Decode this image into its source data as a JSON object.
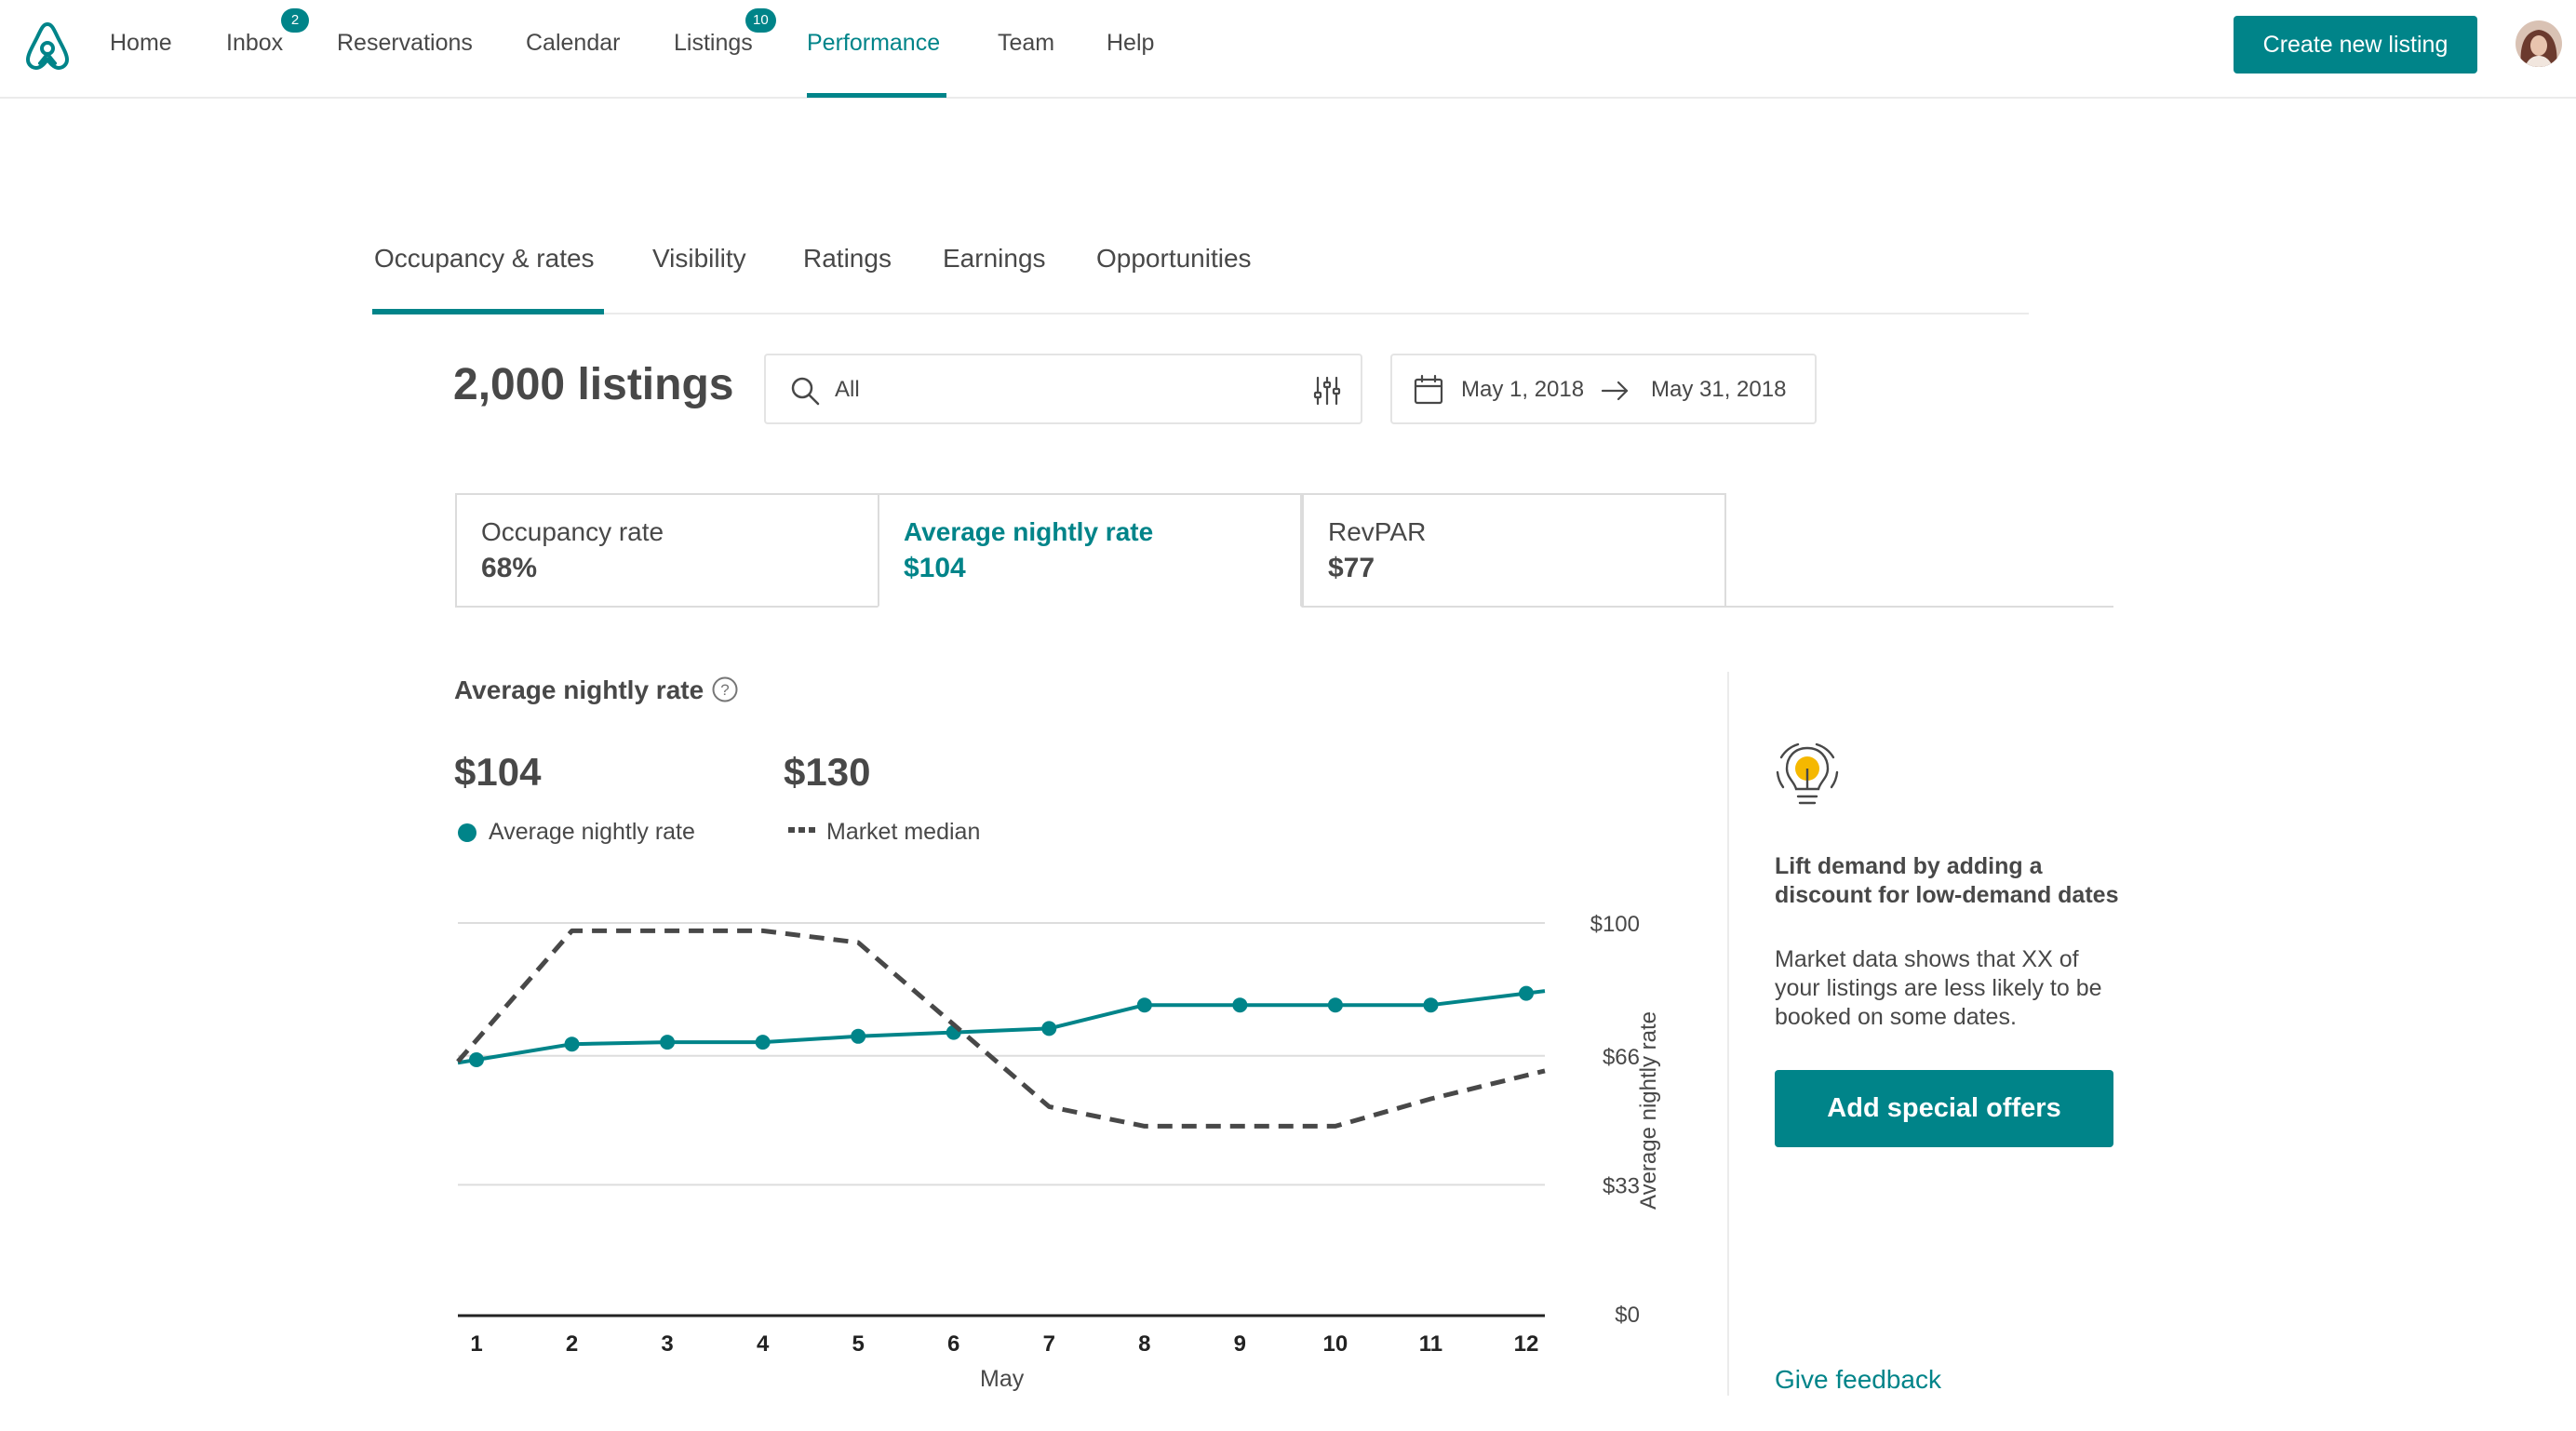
{
  "nav": {
    "items": [
      {
        "label": "Home"
      },
      {
        "label": "Inbox",
        "badge": "2"
      },
      {
        "label": "Reservations"
      },
      {
        "label": "Calendar"
      },
      {
        "label": "Listings",
        "badge": "10"
      },
      {
        "label": "Performance",
        "active": true
      },
      {
        "label": "Team"
      },
      {
        "label": "Help"
      }
    ],
    "create_label": "Create new listing"
  },
  "tabs": [
    {
      "label": "Occupancy & rates",
      "active": true
    },
    {
      "label": "Visibility"
    },
    {
      "label": "Ratings"
    },
    {
      "label": "Earnings"
    },
    {
      "label": "Opportunities"
    }
  ],
  "filters": {
    "listings_count": "2,000 listings",
    "search_value": "All",
    "date_start": "May 1, 2018",
    "date_end": "May 31, 2018"
  },
  "cards": [
    {
      "label": "Occupancy rate",
      "value": "68%"
    },
    {
      "label": "Average nightly rate",
      "value": "$104",
      "active": true
    },
    {
      "label": "RevPAR",
      "value": "$77"
    }
  ],
  "chart_section": {
    "title": "Average nightly rate",
    "stats": [
      {
        "value": "$104",
        "legend": "Average nightly rate"
      },
      {
        "value": "$130",
        "legend": "Market median"
      }
    ]
  },
  "chart_data": {
    "type": "line",
    "x": [
      1,
      2,
      3,
      4,
      5,
      6,
      7,
      8,
      9,
      10,
      11,
      12
    ],
    "x_tick_labels": [
      "1",
      "2",
      "3",
      "4",
      "5",
      "6",
      "7",
      "8",
      "9",
      "10",
      "11",
      "12"
    ],
    "xlabel": "May",
    "ylabel": "Average nightly rate",
    "y_tick_labels": [
      "$0",
      "$33",
      "$66",
      "$100"
    ],
    "y_ticks": [
      0,
      33,
      66,
      100
    ],
    "ylim": [
      0,
      100
    ],
    "series": [
      {
        "name": "Average nightly rate",
        "color": "#008489",
        "style": "solid-with-markers",
        "values": [
          65,
          69,
          69.5,
          69.5,
          71,
          72,
          73,
          79,
          79,
          79,
          79,
          82
        ]
      },
      {
        "name": "Market median",
        "color": "#484848",
        "style": "dashed",
        "values": [
          70,
          98,
          98,
          98,
          95,
          74,
          53,
          48,
          48,
          48,
          55,
          61
        ]
      }
    ]
  },
  "side": {
    "title": "Lift demand by adding a discount for low-demand dates",
    "body": "Market data shows that XX of your listings are less likely to be booked on some dates.",
    "button": "Add special offers",
    "feedback": "Give feedback"
  },
  "colors": {
    "brand": "#008489",
    "text": "#484848",
    "bulb": "#F5B800"
  }
}
